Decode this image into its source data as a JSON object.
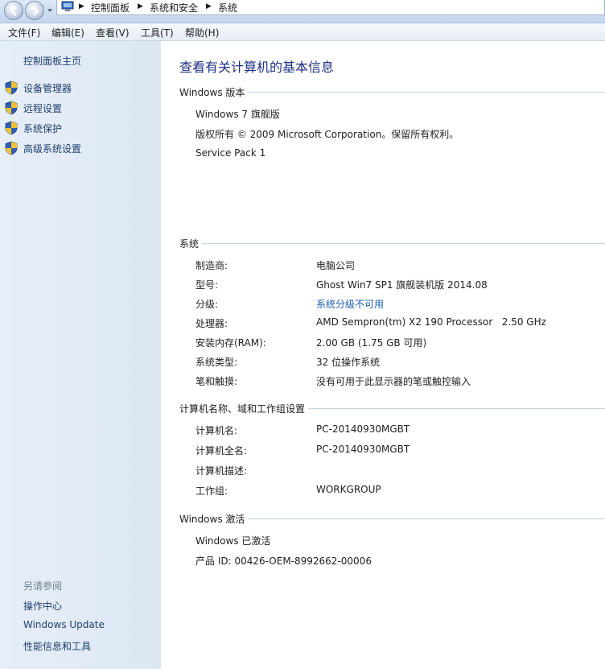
{
  "address_bar": {
    "breadcrumbs": [
      "控制面板",
      "系统和安全",
      "系统"
    ]
  },
  "menu": [
    "文件(F)",
    "编辑(E)",
    "查看(V)",
    "工具(T)",
    "帮助(H)"
  ],
  "sidebar": {
    "home": "控制面板主页",
    "tasks": [
      "设备管理器",
      "远程设置",
      "系统保护",
      "高级系统设置"
    ],
    "see_also_title": "另请参阅",
    "see_also": [
      "操作中心",
      "Windows Update",
      "性能信息和工具"
    ]
  },
  "main": {
    "title": "查看有关计算机的基本信息",
    "edition": {
      "header": "Windows 版本",
      "lines": [
        "Windows 7 旗舰版",
        "版权所有 © 2009 Microsoft Corporation。保留所有权利。",
        "Service Pack 1"
      ]
    },
    "system": {
      "header": "系统",
      "rows": [
        {
          "label": "制造商:",
          "value": "电脑公司"
        },
        {
          "label": "型号:",
          "value": "Ghost Win7 SP1 旗舰装机版 2014.08"
        },
        {
          "label": "分级:",
          "value": "系统分级不可用"
        },
        {
          "label": "处理器:",
          "value": "AMD Sempron(tm) X2 190 Processor   2.50 GHz"
        },
        {
          "label": "安装内存(RAM):",
          "value": "2.00 GB (1.75 GB 可用)"
        },
        {
          "label": "系统类型:",
          "value": "32 位操作系统"
        },
        {
          "label": "笔和触摸:",
          "value": "没有可用于此显示器的笔或触控输入"
        }
      ]
    },
    "computer": {
      "header": "计算机名称、域和工作组设置",
      "rows": [
        {
          "label": "计算机名:",
          "value": "PC-20140930MGBT"
        },
        {
          "label": "计算机全名:",
          "value": "PC-20140930MGBT"
        },
        {
          "label": "计算机描述:",
          "value": ""
        },
        {
          "label": "工作组:",
          "value": "WORKGROUP"
        }
      ]
    },
    "activation": {
      "header": "Windows 激活",
      "lines": [
        "Windows 已激活",
        "产品 ID: 00426-OEM-8992662-00006"
      ]
    }
  },
  "colors": {
    "link": "#1c5fb5",
    "title": "#1e3287",
    "sidebar_bg": "#e2ebf6"
  }
}
